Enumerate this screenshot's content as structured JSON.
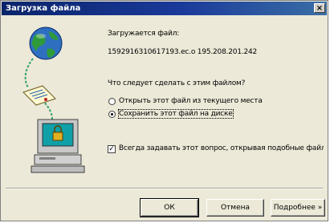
{
  "window": {
    "title": "Загрузка файла",
    "close_glyph": "×"
  },
  "body": {
    "downloading_label": "Загружается файл:",
    "source_text": "1592916310617193.ec.o 195.208.201.242",
    "question": "Что следует сделать с этим файлом?",
    "option_open": "Открыть этот файл из текущего места",
    "option_save": "Сохранить этот файл на диске",
    "selected_option": "save",
    "always_ask_label": "Всегда задавать этот вопрос, открывая подобные файлы",
    "always_ask_checked": true,
    "checkmark": "✓"
  },
  "buttons": {
    "ok": "ОК",
    "cancel": "Отмена",
    "details": "Подробнее »"
  }
}
